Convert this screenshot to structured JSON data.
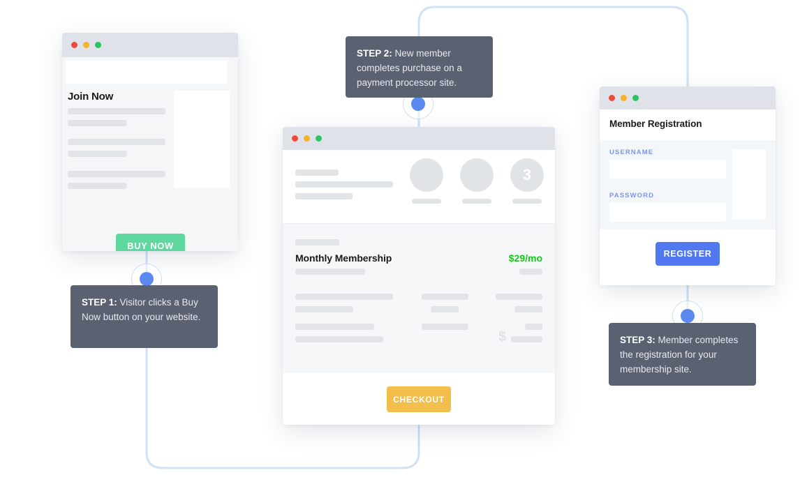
{
  "flow": {
    "accent_line_color": "#cfe0f7",
    "node_color": "#5a8af0",
    "callout_bg": "#5a6272"
  },
  "steps": [
    {
      "id": "step-1",
      "label": "STEP 1:",
      "text": " Visitor clicks a Buy Now button on your website."
    },
    {
      "id": "step-2",
      "label": "STEP 2:",
      "text": " New member completes purchase on a payment processor site."
    },
    {
      "id": "step-3",
      "label": "STEP 3:",
      "text": " Member completes the registration for your membership site."
    }
  ],
  "join_window": {
    "traffic_lights": [
      "close-red",
      "minimize-amber",
      "maximize-green"
    ],
    "heading": "Join Now",
    "buy_button_label": "BUY NOW",
    "buy_button_color": "#5fd8a0",
    "placeholder_rows": 3
  },
  "checkout_window": {
    "traffic_lights": [
      "close-red",
      "minimize-amber",
      "maximize-green"
    ],
    "step_indicator": [
      "",
      "",
      "3"
    ],
    "product_name": "Monthly Membership",
    "price": "$29/mo",
    "price_color": "#19c51f",
    "currency_symbol": "$",
    "checkout_button_label": "CHECKOUT",
    "checkout_button_color": "#f2be4c"
  },
  "register_window": {
    "traffic_lights": [
      "close-red",
      "minimize-amber",
      "maximize-green"
    ],
    "title": "Member Registration",
    "fields": [
      {
        "label": "USERNAME",
        "value": "",
        "placeholder": ""
      },
      {
        "label": "PASSWORD",
        "value": "",
        "placeholder": ""
      }
    ],
    "label_color": "#7b96ec",
    "register_button_label": "REGISTER",
    "register_button_color": "#5278ef"
  }
}
